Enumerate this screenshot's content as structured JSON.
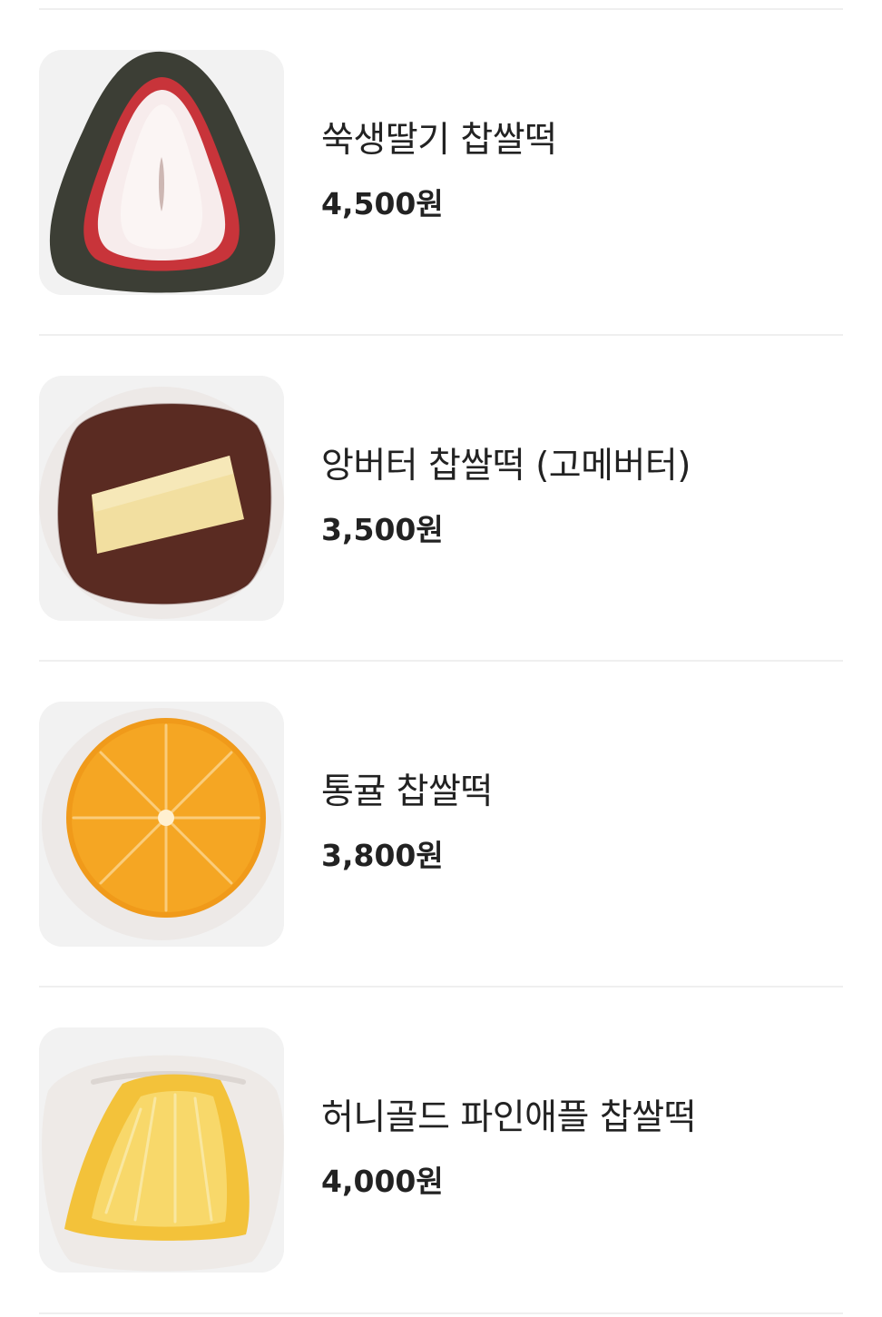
{
  "menu": {
    "items": [
      {
        "name": "쑥생딸기 찹쌀떡",
        "price": "4,500원",
        "image": "mugwort-strawberry-mochi"
      },
      {
        "name": "앙버터 찹쌀떡 (고메버터)",
        "price": "3,500원",
        "image": "red-bean-butter-mochi"
      },
      {
        "name": "통귤 찹쌀떡",
        "price": "3,800원",
        "image": "whole-tangerine-mochi"
      },
      {
        "name": "허니골드 파인애플 찹쌀떡",
        "price": "4,000원",
        "image": "honey-gold-pineapple-mochi"
      }
    ]
  }
}
